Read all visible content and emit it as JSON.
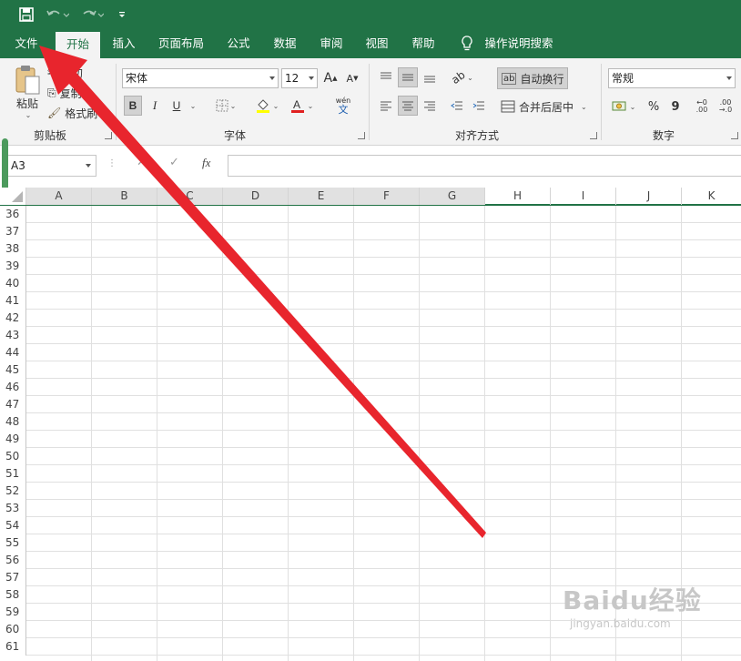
{
  "colors": {
    "accent": "#217346",
    "arrow": "#e8252d"
  },
  "qat": {
    "save_icon": "save-icon",
    "undo_icon": "undo-icon",
    "redo_icon": "redo-icon",
    "customize_icon": "customize-icon"
  },
  "tabs": [
    "文件",
    "开始",
    "插入",
    "页面布局",
    "公式",
    "数据",
    "审阅",
    "视图",
    "帮助"
  ],
  "active_tab": "开始",
  "tell_me": "操作说明搜索",
  "clipboard": {
    "paste": "粘贴",
    "cut": "剪切",
    "copy": "复制",
    "format_painter": "格式刷",
    "label": "剪贴板"
  },
  "font": {
    "name": "宋体",
    "size": "12",
    "bold": "B",
    "italic": "I",
    "underline": "U",
    "phonetic_top": "wén",
    "phonetic_bottom": "文",
    "label": "字体"
  },
  "alignment": {
    "wrap_text": "自动换行",
    "merge_center": "合并后居中",
    "label": "对齐方式"
  },
  "number": {
    "format": "常规",
    "percent": "%",
    "comma": "9",
    "label": "数字"
  },
  "formula_bar": {
    "name_box": "A3",
    "fx": "fx"
  },
  "columns": [
    "A",
    "B",
    "C",
    "D",
    "E",
    "F",
    "G",
    "H",
    "I",
    "J",
    "K"
  ],
  "selected_columns": [
    "A",
    "B",
    "C",
    "D",
    "E",
    "F",
    "G"
  ],
  "rows": [
    "36",
    "37",
    "38",
    "39",
    "40",
    "41",
    "42",
    "43",
    "44",
    "45",
    "46",
    "47",
    "48",
    "49",
    "50",
    "51",
    "52",
    "53",
    "54",
    "55",
    "56",
    "57",
    "58",
    "59",
    "60",
    "61"
  ],
  "watermark": {
    "main": "Baidu经验",
    "sub": "jingyan.baidu.com"
  }
}
